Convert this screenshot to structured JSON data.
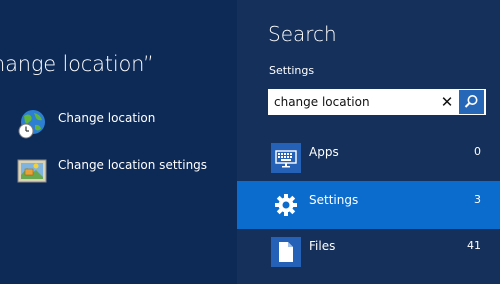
{
  "results": {
    "query_title": "hange location”",
    "items": [
      {
        "label": "Change location",
        "icon": "globe-clock-icon"
      },
      {
        "label": "Change location settings",
        "icon": "location-settings-icon"
      }
    ]
  },
  "search_pane": {
    "title": "Search",
    "scope": "Settings",
    "query": "change location",
    "clear_icon": "close-icon",
    "search_icon": "magnifier-icon",
    "categories": [
      {
        "label": "Apps",
        "count": "0",
        "icon": "keyboard-icon"
      },
      {
        "label": "Settings",
        "count": "3",
        "icon": "gear-icon",
        "selected": true
      },
      {
        "label": "Files",
        "count": "41",
        "icon": "document-icon"
      }
    ]
  },
  "colors": {
    "background": "#0d2a57",
    "pane": "#15305a",
    "selected": "#0c6ccd",
    "tile": "#2561b6"
  }
}
